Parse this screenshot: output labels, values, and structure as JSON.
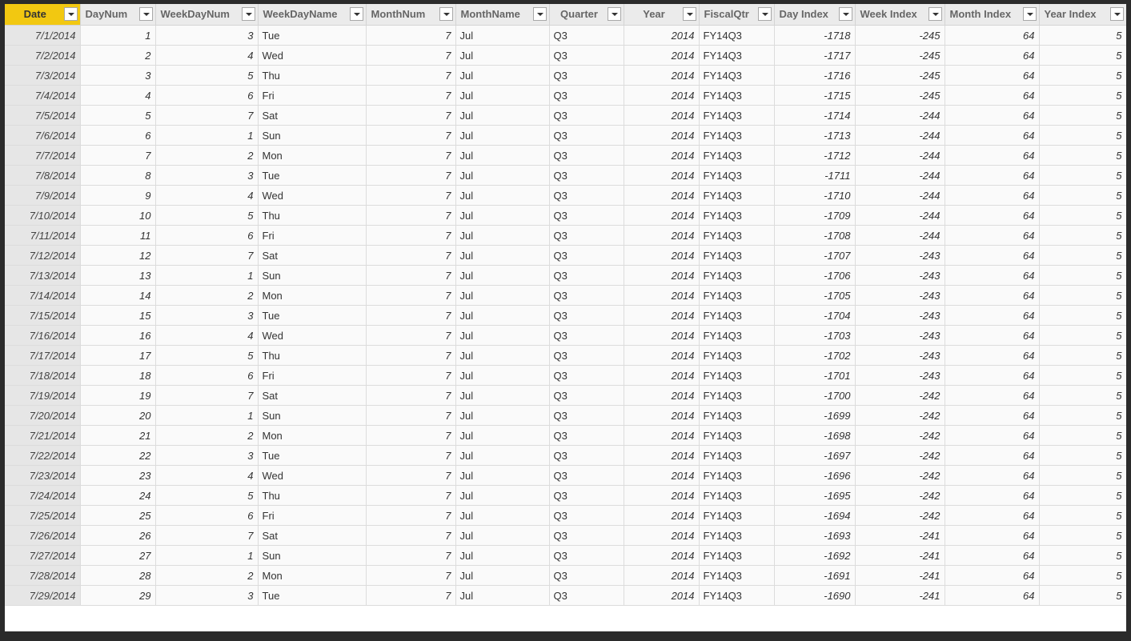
{
  "columns": [
    {
      "key": "date",
      "label": "Date",
      "align": "center",
      "width": 94,
      "active": true
    },
    {
      "key": "daynum",
      "label": "DayNum",
      "align": "left",
      "width": 94
    },
    {
      "key": "weekdaynum",
      "label": "WeekDayNum",
      "align": "left",
      "width": 128
    },
    {
      "key": "weekdayname",
      "label": "WeekDayName",
      "align": "left",
      "width": 135
    },
    {
      "key": "monthnum",
      "label": "MonthNum",
      "align": "left",
      "width": 112
    },
    {
      "key": "monthname",
      "label": "MonthName",
      "align": "left",
      "width": 117
    },
    {
      "key": "quarter",
      "label": "Quarter",
      "align": "center",
      "width": 93
    },
    {
      "key": "year",
      "label": "Year",
      "align": "center",
      "width": 94
    },
    {
      "key": "fiscalqtr",
      "label": "FiscalQtr",
      "align": "left",
      "width": 94
    },
    {
      "key": "dayindex",
      "label": "Day Index",
      "align": "left",
      "width": 101
    },
    {
      "key": "weekindex",
      "label": "Week Index",
      "align": "left",
      "width": 112
    },
    {
      "key": "monthindex",
      "label": "Month Index",
      "align": "left",
      "width": 118
    },
    {
      "key": "yearindex",
      "label": "Year Index",
      "align": "left",
      "width": 109
    }
  ],
  "rows": [
    [
      "7/1/2014",
      "1",
      "3",
      "Tue",
      "7",
      "Jul",
      "Q3",
      "2014",
      "FY14Q3",
      "-1718",
      "-245",
      "64",
      "5"
    ],
    [
      "7/2/2014",
      "2",
      "4",
      "Wed",
      "7",
      "Jul",
      "Q3",
      "2014",
      "FY14Q3",
      "-1717",
      "-245",
      "64",
      "5"
    ],
    [
      "7/3/2014",
      "3",
      "5",
      "Thu",
      "7",
      "Jul",
      "Q3",
      "2014",
      "FY14Q3",
      "-1716",
      "-245",
      "64",
      "5"
    ],
    [
      "7/4/2014",
      "4",
      "6",
      "Fri",
      "7",
      "Jul",
      "Q3",
      "2014",
      "FY14Q3",
      "-1715",
      "-245",
      "64",
      "5"
    ],
    [
      "7/5/2014",
      "5",
      "7",
      "Sat",
      "7",
      "Jul",
      "Q3",
      "2014",
      "FY14Q3",
      "-1714",
      "-244",
      "64",
      "5"
    ],
    [
      "7/6/2014",
      "6",
      "1",
      "Sun",
      "7",
      "Jul",
      "Q3",
      "2014",
      "FY14Q3",
      "-1713",
      "-244",
      "64",
      "5"
    ],
    [
      "7/7/2014",
      "7",
      "2",
      "Mon",
      "7",
      "Jul",
      "Q3",
      "2014",
      "FY14Q3",
      "-1712",
      "-244",
      "64",
      "5"
    ],
    [
      "7/8/2014",
      "8",
      "3",
      "Tue",
      "7",
      "Jul",
      "Q3",
      "2014",
      "FY14Q3",
      "-1711",
      "-244",
      "64",
      "5"
    ],
    [
      "7/9/2014",
      "9",
      "4",
      "Wed",
      "7",
      "Jul",
      "Q3",
      "2014",
      "FY14Q3",
      "-1710",
      "-244",
      "64",
      "5"
    ],
    [
      "7/10/2014",
      "10",
      "5",
      "Thu",
      "7",
      "Jul",
      "Q3",
      "2014",
      "FY14Q3",
      "-1709",
      "-244",
      "64",
      "5"
    ],
    [
      "7/11/2014",
      "11",
      "6",
      "Fri",
      "7",
      "Jul",
      "Q3",
      "2014",
      "FY14Q3",
      "-1708",
      "-244",
      "64",
      "5"
    ],
    [
      "7/12/2014",
      "12",
      "7",
      "Sat",
      "7",
      "Jul",
      "Q3",
      "2014",
      "FY14Q3",
      "-1707",
      "-243",
      "64",
      "5"
    ],
    [
      "7/13/2014",
      "13",
      "1",
      "Sun",
      "7",
      "Jul",
      "Q3",
      "2014",
      "FY14Q3",
      "-1706",
      "-243",
      "64",
      "5"
    ],
    [
      "7/14/2014",
      "14",
      "2",
      "Mon",
      "7",
      "Jul",
      "Q3",
      "2014",
      "FY14Q3",
      "-1705",
      "-243",
      "64",
      "5"
    ],
    [
      "7/15/2014",
      "15",
      "3",
      "Tue",
      "7",
      "Jul",
      "Q3",
      "2014",
      "FY14Q3",
      "-1704",
      "-243",
      "64",
      "5"
    ],
    [
      "7/16/2014",
      "16",
      "4",
      "Wed",
      "7",
      "Jul",
      "Q3",
      "2014",
      "FY14Q3",
      "-1703",
      "-243",
      "64",
      "5"
    ],
    [
      "7/17/2014",
      "17",
      "5",
      "Thu",
      "7",
      "Jul",
      "Q3",
      "2014",
      "FY14Q3",
      "-1702",
      "-243",
      "64",
      "5"
    ],
    [
      "7/18/2014",
      "18",
      "6",
      "Fri",
      "7",
      "Jul",
      "Q3",
      "2014",
      "FY14Q3",
      "-1701",
      "-243",
      "64",
      "5"
    ],
    [
      "7/19/2014",
      "19",
      "7",
      "Sat",
      "7",
      "Jul",
      "Q3",
      "2014",
      "FY14Q3",
      "-1700",
      "-242",
      "64",
      "5"
    ],
    [
      "7/20/2014",
      "20",
      "1",
      "Sun",
      "7",
      "Jul",
      "Q3",
      "2014",
      "FY14Q3",
      "-1699",
      "-242",
      "64",
      "5"
    ],
    [
      "7/21/2014",
      "21",
      "2",
      "Mon",
      "7",
      "Jul",
      "Q3",
      "2014",
      "FY14Q3",
      "-1698",
      "-242",
      "64",
      "5"
    ],
    [
      "7/22/2014",
      "22",
      "3",
      "Tue",
      "7",
      "Jul",
      "Q3",
      "2014",
      "FY14Q3",
      "-1697",
      "-242",
      "64",
      "5"
    ],
    [
      "7/23/2014",
      "23",
      "4",
      "Wed",
      "7",
      "Jul",
      "Q3",
      "2014",
      "FY14Q3",
      "-1696",
      "-242",
      "64",
      "5"
    ],
    [
      "7/24/2014",
      "24",
      "5",
      "Thu",
      "7",
      "Jul",
      "Q3",
      "2014",
      "FY14Q3",
      "-1695",
      "-242",
      "64",
      "5"
    ],
    [
      "7/25/2014",
      "25",
      "6",
      "Fri",
      "7",
      "Jul",
      "Q3",
      "2014",
      "FY14Q3",
      "-1694",
      "-242",
      "64",
      "5"
    ],
    [
      "7/26/2014",
      "26",
      "7",
      "Sat",
      "7",
      "Jul",
      "Q3",
      "2014",
      "FY14Q3",
      "-1693",
      "-241",
      "64",
      "5"
    ],
    [
      "7/27/2014",
      "27",
      "1",
      "Sun",
      "7",
      "Jul",
      "Q3",
      "2014",
      "FY14Q3",
      "-1692",
      "-241",
      "64",
      "5"
    ],
    [
      "7/28/2014",
      "28",
      "2",
      "Mon",
      "7",
      "Jul",
      "Q3",
      "2014",
      "FY14Q3",
      "-1691",
      "-241",
      "64",
      "5"
    ],
    [
      "7/29/2014",
      "29",
      "3",
      "Tue",
      "7",
      "Jul",
      "Q3",
      "2014",
      "FY14Q3",
      "-1690",
      "-241",
      "64",
      "5"
    ]
  ],
  "column_types": [
    "date",
    "num",
    "num",
    "txt",
    "num",
    "txt",
    "txt",
    "num",
    "txt",
    "num",
    "num",
    "num",
    "num"
  ],
  "colors": {
    "active_header": "#f2c811",
    "header_bg": "#ebebeb",
    "frame": "#2b2b2b"
  },
  "icons": {
    "filter": "chevron-down-icon"
  }
}
